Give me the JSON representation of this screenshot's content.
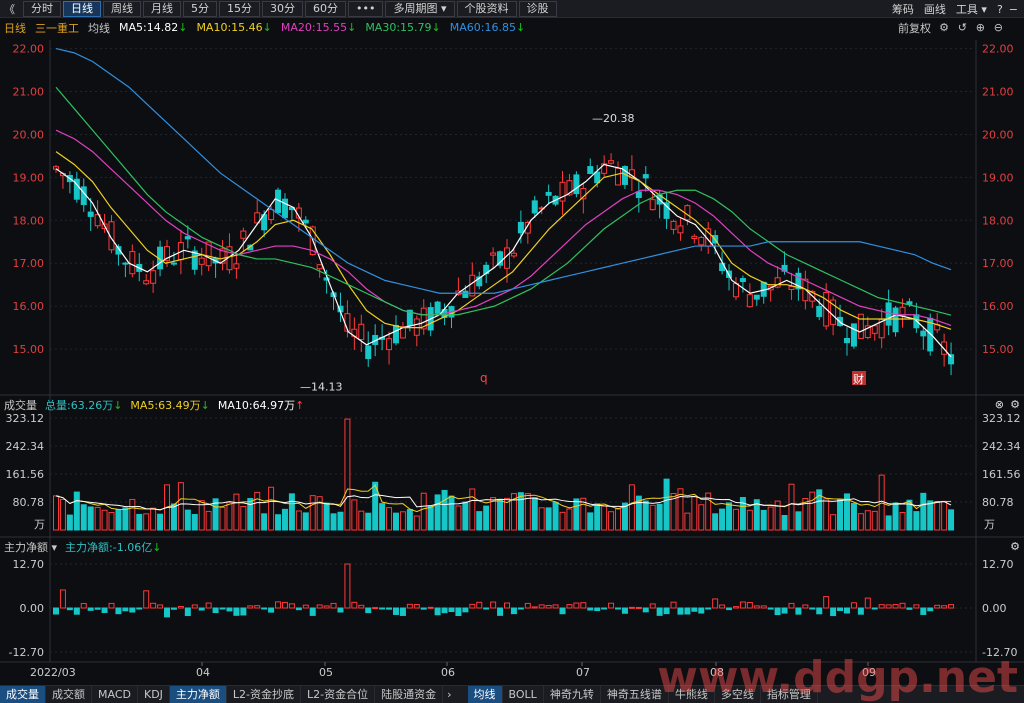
{
  "toolbar": {
    "back_icon": "double-chevron-left-icon",
    "buttons": [
      "分时",
      "日线",
      "周线",
      "月线",
      "5分",
      "15分",
      "30分",
      "60分",
      "•••",
      "多周期图 ▾",
      "个股资料",
      "诊股"
    ],
    "active_index": 1,
    "right": [
      "筹码",
      "画线",
      "工具 ▾"
    ],
    "window_icons": [
      "?",
      "−"
    ]
  },
  "info": {
    "period": "日线",
    "stock_name": "三一重工",
    "ma_label": "均线",
    "ma5": "MA5:14.82",
    "ma10": "MA10:15.46",
    "ma20": "MA20:15.55",
    "ma30": "MA30:15.79",
    "ma60": "MA60:16.85",
    "adjust": "前复权",
    "colors": {
      "ma5": "#ffffff",
      "ma10": "#f0d020",
      "ma20": "#e040c0",
      "ma30": "#30c060",
      "ma60": "#3090e0"
    }
  },
  "price_panel": {
    "y_ticks": [
      "22.00",
      "21.00",
      "20.00",
      "19.00",
      "18.00",
      "17.00",
      "16.00",
      "15.00"
    ],
    "high_label": "20.38",
    "low_label": "14.13",
    "marker_q": "q",
    "marker_cai": "财"
  },
  "volume_panel": {
    "title": "成交量",
    "total": "总量:63.26万",
    "ma5": "MA5:63.49万",
    "ma10": "MA10:64.97万",
    "y_ticks": [
      "323.12",
      "242.34",
      "161.56",
      "80.78"
    ],
    "unit": "万"
  },
  "flow_panel": {
    "title": "主力净额 ▾",
    "value": "主力净额:-1.06亿",
    "y_ticks": [
      "12.70",
      "0.00",
      "-12.70"
    ]
  },
  "x_axis": [
    "2022/03",
    "04",
    "05",
    "06",
    "07",
    "08",
    "09"
  ],
  "bottom_tabs_left": [
    "成交量",
    "成交额",
    "MACD",
    "KDJ",
    "主力净额",
    "L2-资金抄底",
    "L2-资金合位",
    "陆股通资金"
  ],
  "bottom_tabs_right": [
    "均线",
    "BOLL",
    "神奇九转",
    "神奇五线谱",
    "牛熊线",
    "多空线",
    "指标管理"
  ],
  "watermark": "www.ddgp.net",
  "chart_data": {
    "type": "candlestick",
    "title": "",
    "ylim": [
      14.0,
      22.2
    ],
    "x": [
      "2022/03",
      "04",
      "05",
      "06",
      "07",
      "08",
      "09"
    ],
    "series": [
      {
        "name": "MA5",
        "values": [
          19.2,
          18.9,
          18.4,
          17.6,
          17.0,
          16.8,
          17.1,
          17.3,
          17.2,
          17.0,
          17.3,
          17.9,
          18.5,
          18.3,
          17.6,
          16.5,
          15.4,
          15.1,
          15.3,
          15.5,
          15.6,
          15.8,
          16.3,
          16.6,
          16.9,
          17.3,
          18.0,
          18.4,
          18.6,
          18.9,
          19.3,
          19.2,
          18.9,
          18.5,
          18.1,
          17.9,
          17.4,
          16.6,
          16.3,
          16.4,
          16.6,
          16.4,
          16.0,
          15.6,
          15.4,
          15.6,
          15.8,
          15.7,
          15.3,
          14.82
        ]
      },
      {
        "name": "MA10",
        "values": [
          19.6,
          19.3,
          18.9,
          18.3,
          17.8,
          17.3,
          17.0,
          17.1,
          17.2,
          17.1,
          17.2,
          17.5,
          17.9,
          18.0,
          17.8,
          17.2,
          16.5,
          15.9,
          15.6,
          15.5,
          15.5,
          15.7,
          15.9,
          16.2,
          16.5,
          16.8,
          17.3,
          17.8,
          18.2,
          18.6,
          19.0,
          19.1,
          18.9,
          18.6,
          18.3,
          18.0,
          17.6,
          17.0,
          16.7,
          16.5,
          16.5,
          16.4,
          16.2,
          15.9,
          15.7,
          15.7,
          15.7,
          15.7,
          15.6,
          15.46
        ]
      },
      {
        "name": "MA20",
        "values": [
          20.1,
          19.9,
          19.6,
          19.2,
          18.8,
          18.4,
          18.0,
          17.7,
          17.5,
          17.3,
          17.2,
          17.3,
          17.4,
          17.4,
          17.3,
          17.1,
          16.8,
          16.4,
          16.1,
          15.9,
          15.8,
          15.8,
          15.9,
          16.0,
          16.2,
          16.4,
          16.7,
          17.1,
          17.5,
          17.9,
          18.2,
          18.5,
          18.7,
          18.7,
          18.6,
          18.4,
          18.1,
          17.7,
          17.3,
          17.0,
          16.8,
          16.6,
          16.4,
          16.2,
          16.0,
          15.9,
          15.8,
          15.8,
          15.7,
          15.55
        ]
      },
      {
        "name": "MA30",
        "values": [
          21.1,
          20.6,
          20.1,
          19.6,
          19.1,
          18.6,
          18.2,
          17.9,
          17.6,
          17.4,
          17.2,
          17.1,
          17.1,
          17.0,
          16.9,
          16.7,
          16.5,
          16.3,
          16.1,
          15.9,
          15.8,
          15.8,
          15.8,
          15.9,
          16.0,
          16.2,
          16.4,
          16.7,
          17.0,
          17.4,
          17.8,
          18.1,
          18.4,
          18.6,
          18.7,
          18.7,
          18.5,
          18.2,
          17.8,
          17.5,
          17.2,
          17.0,
          16.8,
          16.6,
          16.4,
          16.2,
          16.1,
          16.0,
          15.9,
          15.79
        ]
      },
      {
        "name": "MA60",
        "values": [
          22.0,
          21.9,
          21.7,
          21.4,
          21.1,
          20.7,
          20.3,
          19.9,
          19.5,
          19.1,
          18.8,
          18.5,
          18.2,
          17.9,
          17.6,
          17.3,
          17.0,
          16.8,
          16.6,
          16.5,
          16.4,
          16.3,
          16.3,
          16.3,
          16.3,
          16.4,
          16.5,
          16.6,
          16.7,
          16.8,
          16.9,
          17.0,
          17.1,
          17.2,
          17.3,
          17.4,
          17.4,
          17.4,
          17.4,
          17.5,
          17.5,
          17.5,
          17.5,
          17.5,
          17.5,
          17.4,
          17.3,
          17.2,
          17.0,
          16.85
        ]
      }
    ],
    "high": 20.38,
    "low": 14.13
  }
}
